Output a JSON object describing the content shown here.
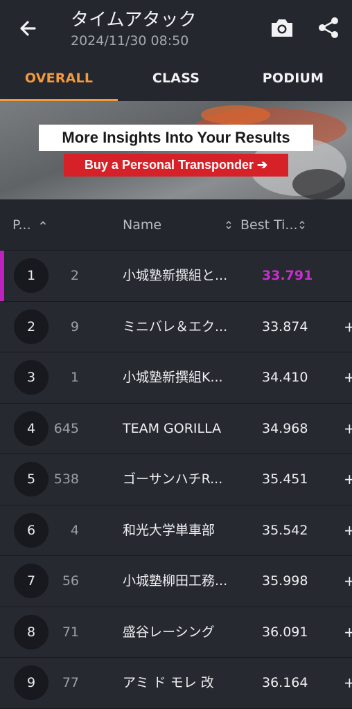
{
  "header": {
    "title": "タイムアタック",
    "datetime": "2024/11/30 08:50",
    "back_icon": "arrow-back-icon",
    "camera_icon": "camera-icon",
    "share_icon": "share-icon"
  },
  "tabs": [
    {
      "label": "OVERALL",
      "active": true
    },
    {
      "label": "CLASS",
      "active": false
    },
    {
      "label": "PODIUM",
      "active": false
    }
  ],
  "banner": {
    "headline": "More Insights Into Your Results",
    "cta": "Buy a Personal Transponder ➔"
  },
  "columns": {
    "position": "P...",
    "name": "Name",
    "best_time": "Best Ti..."
  },
  "colors": {
    "accent": "#f39a3d",
    "fastest": "#c92ed0",
    "cta": "#d72128"
  },
  "rows": [
    {
      "pos": "1",
      "num": "2",
      "name": "小城塾新撰組と...",
      "best": "33.791",
      "fastest": true,
      "more": ""
    },
    {
      "pos": "2",
      "num": "9",
      "name": "ミニバレ＆エク...",
      "best": "33.874",
      "fastest": false,
      "more": "+"
    },
    {
      "pos": "3",
      "num": "1",
      "name": "小城塾新撰組K...",
      "best": "34.410",
      "fastest": false,
      "more": "+"
    },
    {
      "pos": "4",
      "num": "645",
      "name": "TEAM GORILLA",
      "best": "34.968",
      "fastest": false,
      "more": "+"
    },
    {
      "pos": "5",
      "num": "538",
      "name": "ゴーサンハチR...",
      "best": "35.451",
      "fastest": false,
      "more": "+"
    },
    {
      "pos": "6",
      "num": "4",
      "name": "和光大学単車部",
      "best": "35.542",
      "fastest": false,
      "more": "+"
    },
    {
      "pos": "7",
      "num": "56",
      "name": "小城塾柳田工務...",
      "best": "35.998",
      "fastest": false,
      "more": "+"
    },
    {
      "pos": "8",
      "num": "71",
      "name": "盛谷レーシング",
      "best": "36.091",
      "fastest": false,
      "more": "+"
    },
    {
      "pos": "9",
      "num": "77",
      "name": "アミ ド モレ 改",
      "best": "36.164",
      "fastest": false,
      "more": "+"
    }
  ]
}
